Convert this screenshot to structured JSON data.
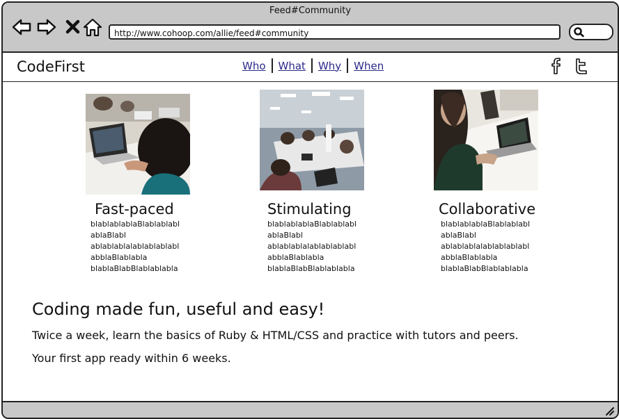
{
  "window": {
    "title": "Feed#Community",
    "url": "http://www.cohoop.com/allie/feed#community"
  },
  "header": {
    "logo": "CodeFirst",
    "nav": [
      {
        "label": "Who"
      },
      {
        "label": "What"
      },
      {
        "label": "Why"
      },
      {
        "label": "When"
      }
    ],
    "social": [
      "facebook-icon",
      "twitter-icon"
    ]
  },
  "features": [
    {
      "title": "Fast-paced",
      "lines": [
        "blablablablaBlablablabl",
        "ablaBlabl",
        "ablablablalablablablabl",
        "abblaBlablabla",
        "blablaBlabBlablablabla"
      ]
    },
    {
      "title": "Stimulating",
      "lines": [
        "blablablablaBlablablabl",
        "ablaBlabl",
        "ablablablalablablablabl",
        "abblaBlablabla",
        "blablaBlabBlablablabla"
      ]
    },
    {
      "title": "Collaborative",
      "lines": [
        "blablablablaBlablablabl",
        "ablaBlabl",
        "ablablablalablablablabl",
        "abblaBlablabla",
        "blablaBlabBlablablabla"
      ]
    }
  ],
  "pitch": {
    "headline": "Coding made fun, useful and easy!",
    "line1": "Twice a week, learn the basics of Ruby & HTML/CSS and practice with tutors and peers.",
    "line2": "Your first app ready within 6 weeks."
  },
  "colors": {
    "chrome": "#c8c8c8",
    "link": "#2b2a8a",
    "border": "#222222"
  }
}
